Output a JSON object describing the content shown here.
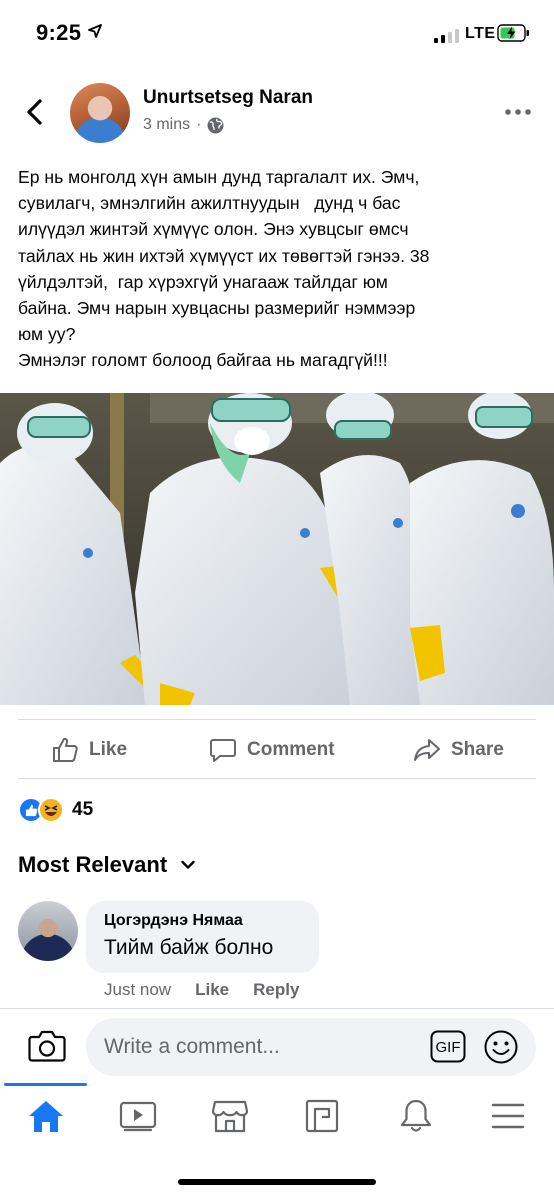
{
  "status_bar": {
    "time": "9:25",
    "network": "LTE"
  },
  "post": {
    "author": "Unurtsetseg Naran",
    "time_ago": "3 mins",
    "separator": "·",
    "body": "Ер нь монголд хүн амын дунд таргалалт их. Эмч,\nсувилагч, эмнэлгийн ажилтнуудын   дунд ч бас\nилүүдэл жинтэй хүмүүс олон. Энэ хувцсыг өмсч\nтайлах нь жин ихтэй хүмүүст их төвөгтэй гэнээ. 38\nүйлдэлтэй,  гар хүрэхгүй унагааж тайлдаг юм\nбайна. Эмч нарын хувцасны размерийг нэммээр\nюм уу?\nЭмнэлэг голомт болоод байгаа нь магадгүй!!!"
  },
  "actions": {
    "like": "Like",
    "comment": "Comment",
    "share": "Share"
  },
  "reactions": {
    "count": "45",
    "types": [
      "like-icon",
      "haha-icon"
    ]
  },
  "comments_section": {
    "sort_label": "Most Relevant",
    "comments": [
      {
        "author": "Цогэрдэнэ Нямаа",
        "text": "Тийм байж болно",
        "time": "Just now",
        "like_label": "Like",
        "reply_label": "Reply"
      }
    ]
  },
  "composer": {
    "placeholder": "Write a comment...",
    "gif_label": "GIF"
  },
  "bottom_nav": {
    "items": [
      "home-icon",
      "watch-icon",
      "marketplace-icon",
      "pages-icon",
      "notifications-icon",
      "menu-icon"
    ],
    "active": "home-icon"
  },
  "colors": {
    "accent": "#1877f2",
    "secondary_text": "#65676b",
    "bubble": "#f0f2f5"
  }
}
